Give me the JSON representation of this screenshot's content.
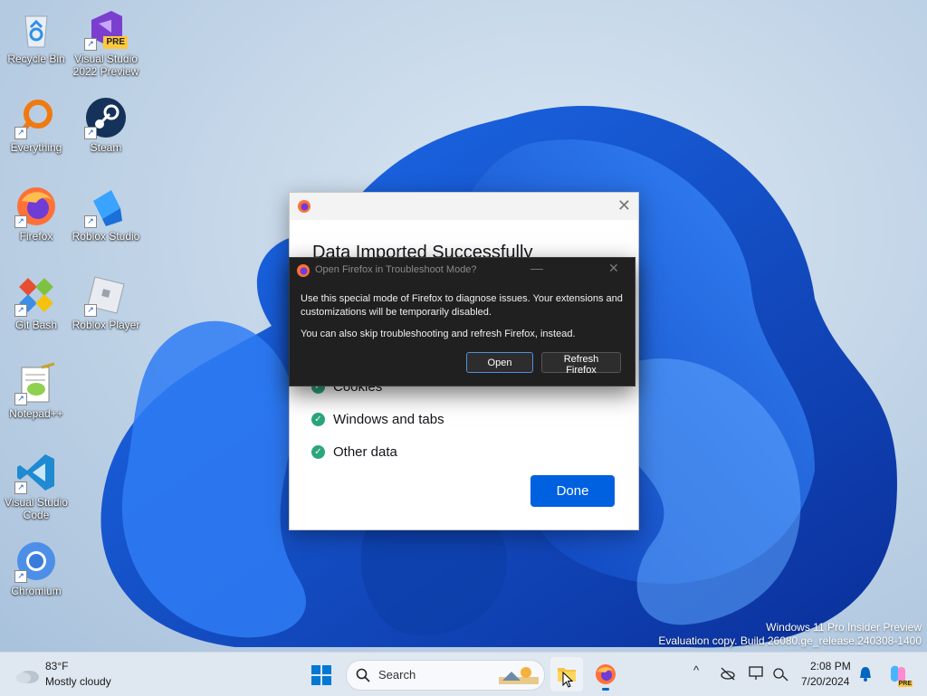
{
  "desktop": {
    "icons": [
      {
        "label": "Recycle Bin",
        "icon": "recycle-bin-icon"
      },
      {
        "label": "Visual Studio 2022 Preview",
        "icon": "visual-studio-preview-icon",
        "badge": "PRE"
      },
      {
        "label": "Everything",
        "icon": "everything-search-icon"
      },
      {
        "label": "Steam",
        "icon": "steam-icon"
      },
      {
        "label": "Firefox",
        "icon": "firefox-icon"
      },
      {
        "label": "Roblox Studio",
        "icon": "roblox-studio-icon"
      },
      {
        "label": "Git Bash",
        "icon": "git-bash-icon"
      },
      {
        "label": "Roblox Player",
        "icon": "roblox-player-icon"
      },
      {
        "label": "Notepad++",
        "icon": "notepad-plus-plus-icon"
      },
      {
        "label": "Visual Studio Code",
        "icon": "vscode-icon"
      },
      {
        "label": "Chromium",
        "icon": "chromium-icon"
      }
    ]
  },
  "watermark": {
    "line1": "Windows 11 Pro Insider Preview",
    "line2": "Evaluation copy. Build 26080.ge_release.240308-1400"
  },
  "import_dialog": {
    "close": "✕",
    "title": "Data Imported Successfully",
    "items": [
      "Cookies",
      "Windows and tabs",
      "Other data"
    ],
    "done_label": "Done"
  },
  "troubleshoot_dialog": {
    "title": "Open Firefox in Troubleshoot Mode?",
    "minimize": "—",
    "close": "✕",
    "paragraph1": "Use this special mode of Firefox to diagnose issues. Your extensions and customizations will be temporarily disabled.",
    "paragraph2": "You can also skip troubleshooting and refresh Firefox, instead.",
    "open_label": "Open",
    "refresh_label": "Refresh Firefox"
  },
  "taskbar": {
    "weather_temp": "83°F",
    "weather_desc": "Mostly cloudy",
    "search_label": "Search",
    "time": "2:08 PM",
    "date": "7/20/2024",
    "tray_chevron": "^",
    "copilot_badge": "PRE"
  },
  "colors": {
    "accent": "#0061e0",
    "check_green": "#2ba67b",
    "dialog_dark": "#202020"
  }
}
